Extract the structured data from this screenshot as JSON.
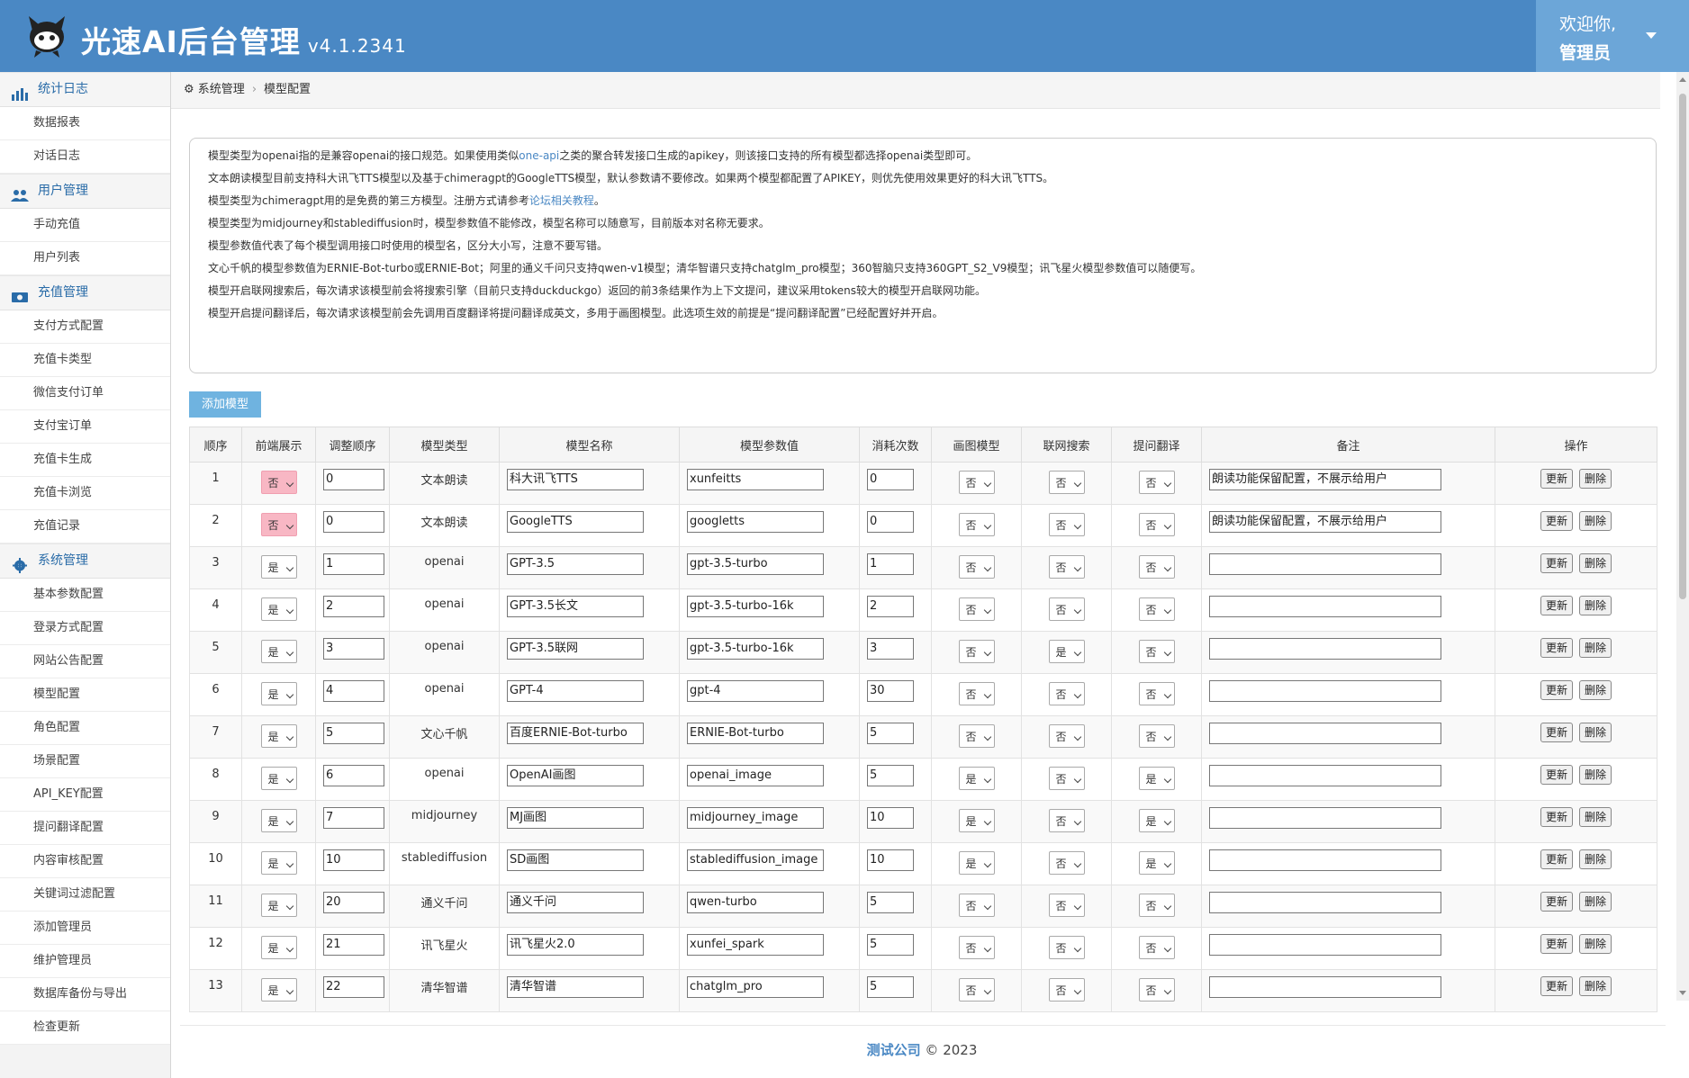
{
  "header": {
    "title": "光速AI后台管理",
    "version": "v4.1.2341",
    "welcome": "欢迎你,",
    "username": "管理员"
  },
  "sidebar": {
    "groups": [
      {
        "label": "统计日志",
        "icon": "bar-chart-icon",
        "items": [
          "数据报表",
          "对话日志"
        ]
      },
      {
        "label": "用户管理",
        "icon": "users-icon",
        "items": [
          "手动充值",
          "用户列表"
        ]
      },
      {
        "label": "充值管理",
        "icon": "money-icon",
        "items": [
          "支付方式配置",
          "充值卡类型",
          "微信支付订单",
          "支付宝订单",
          "充值卡生成",
          "充值卡浏览",
          "充值记录"
        ]
      },
      {
        "label": "系统管理",
        "icon": "gear-icon",
        "items": [
          "基本参数配置",
          "登录方式配置",
          "网站公告配置",
          "模型配置",
          "角色配置",
          "场景配置",
          "API_KEY配置",
          "提问翻译配置",
          "内容审核配置",
          "关键词过滤配置",
          "添加管理员",
          "维护管理员",
          "数据库备份与导出",
          "检查更新"
        ]
      }
    ]
  },
  "breadcrumb": {
    "root": "系统管理",
    "current": "模型配置"
  },
  "notice": {
    "line1_a": "模型类型为openai指的是兼容openai的接口规范。如果使用类似",
    "line1_link": "one-api",
    "line1_b": "之类的聚合转发接口生成的apikey，则该接口支持的所有模型都选择openai类型即可。",
    "line2": "文本朗读模型目前支持科大讯飞TTS模型以及基于chimeragpt的GoogleTTS模型，默认参数请不要修改。如果两个模型都配置了APIKEY，则优先使用效果更好的科大讯飞TTS。",
    "line3_a": "模型类型为chimeragpt用的是免费的第三方模型。注册方式请参考",
    "line3_link": "论坛相关教程",
    "line3_b": "。",
    "line4": "模型类型为midjourney和stablediffusion时，模型参数值不能修改，模型名称可以随意写，目前版本对名称无要求。",
    "line5": "模型参数值代表了每个模型调用接口时使用的模型名，区分大小写，注意不要写错。",
    "line6": "文心千帆的模型参数值为ERNIE-Bot-turbo或ERNIE-Bot；阿里的通义千问只支持qwen-v1模型；清华智谱只支持chatglm_pro模型；360智脑只支持360GPT_S2_V9模型；讯飞星火模型参数值可以随便写。",
    "line7": "模型开启联网搜索后，每次请求该模型前会将搜索引擎（目前只支持duckduckgo）返回的前3条结果作为上下文提问，建议采用tokens较大的模型开启联网功能。",
    "line8": "模型开启提问翻译后，每次请求该模型前会先调用百度翻译将提问翻译成英文，多用于画图模型。此选项生效的前提是“提问翻译配置”已经配置好并开启。"
  },
  "add_button": "添加模型",
  "table": {
    "headers": [
      "顺序",
      "前端展示",
      "调整顺序",
      "模型类型",
      "模型名称",
      "模型参数值",
      "消耗次数",
      "画图模型",
      "联网搜索",
      "提问翻译",
      "备注",
      "操作"
    ],
    "update_label": "更新",
    "delete_label": "删除",
    "rows": [
      {
        "no": "1",
        "show": "否",
        "order": "0",
        "type": "文本朗读",
        "name": "科大讯飞TTS",
        "param": "xunfeitts",
        "cost": "0",
        "draw": "否",
        "web": "否",
        "trans": "否",
        "note": "朗读功能保留配置，不展示给用户"
      },
      {
        "no": "2",
        "show": "否",
        "order": "0",
        "type": "文本朗读",
        "name": "GoogleTTS",
        "param": "googletts",
        "cost": "0",
        "draw": "否",
        "web": "否",
        "trans": "否",
        "note": "朗读功能保留配置，不展示给用户"
      },
      {
        "no": "3",
        "show": "是",
        "order": "1",
        "type": "openai",
        "name": "GPT-3.5",
        "param": "gpt-3.5-turbo",
        "cost": "1",
        "draw": "否",
        "web": "否",
        "trans": "否",
        "note": ""
      },
      {
        "no": "4",
        "show": "是",
        "order": "2",
        "type": "openai",
        "name": "GPT-3.5长文",
        "param": "gpt-3.5-turbo-16k",
        "cost": "2",
        "draw": "否",
        "web": "否",
        "trans": "否",
        "note": ""
      },
      {
        "no": "5",
        "show": "是",
        "order": "3",
        "type": "openai",
        "name": "GPT-3.5联网",
        "param": "gpt-3.5-turbo-16k",
        "cost": "3",
        "draw": "否",
        "web": "是",
        "trans": "否",
        "note": ""
      },
      {
        "no": "6",
        "show": "是",
        "order": "4",
        "type": "openai",
        "name": "GPT-4",
        "param": "gpt-4",
        "cost": "30",
        "draw": "否",
        "web": "否",
        "trans": "否",
        "note": ""
      },
      {
        "no": "7",
        "show": "是",
        "order": "5",
        "type": "文心千帆",
        "name": "百度ERNIE-Bot-turbo",
        "param": "ERNIE-Bot-turbo",
        "cost": "5",
        "draw": "否",
        "web": "否",
        "trans": "否",
        "note": ""
      },
      {
        "no": "8",
        "show": "是",
        "order": "6",
        "type": "openai",
        "name": "OpenAI画图",
        "param": "openai_image",
        "cost": "5",
        "draw": "是",
        "web": "否",
        "trans": "是",
        "note": ""
      },
      {
        "no": "9",
        "show": "是",
        "order": "7",
        "type": "midjourney",
        "name": "MJ画图",
        "param": "midjourney_image",
        "cost": "10",
        "draw": "是",
        "web": "否",
        "trans": "是",
        "note": ""
      },
      {
        "no": "10",
        "show": "是",
        "order": "10",
        "type": "stablediffusion",
        "name": "SD画图",
        "param": "stablediffusion_image",
        "cost": "10",
        "draw": "是",
        "web": "否",
        "trans": "是",
        "note": ""
      },
      {
        "no": "11",
        "show": "是",
        "order": "20",
        "type": "通义千问",
        "name": "通义千问",
        "param": "qwen-turbo",
        "cost": "5",
        "draw": "否",
        "web": "否",
        "trans": "否",
        "note": ""
      },
      {
        "no": "12",
        "show": "是",
        "order": "21",
        "type": "讯飞星火",
        "name": "讯飞星火2.0",
        "param": "xunfei_spark",
        "cost": "5",
        "draw": "否",
        "web": "否",
        "trans": "否",
        "note": ""
      },
      {
        "no": "13",
        "show": "是",
        "order": "22",
        "type": "清华智谱",
        "name": "清华智谱",
        "param": "chatglm_pro",
        "cost": "5",
        "draw": "否",
        "web": "否",
        "trans": "否",
        "note": ""
      }
    ]
  },
  "footer": {
    "company": "测试公司",
    "copyright": "© 2023"
  },
  "colors": {
    "header_bg": "#4a88c4",
    "user_bg": "#6ca6d8",
    "link": "#4a88c4",
    "no_highlight": "#f8b7c4",
    "add_button": "#6fb3e0"
  }
}
